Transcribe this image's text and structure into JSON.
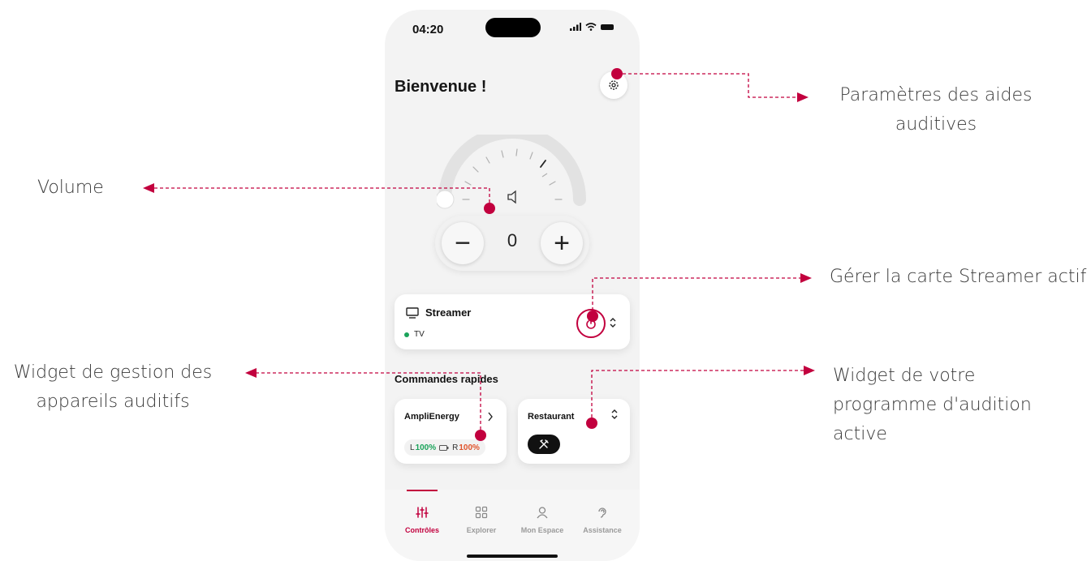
{
  "annotations": {
    "settings": [
      "Paramètres des aides",
      "auditives"
    ],
    "volume": "Volume",
    "streamer": "Gérer la carte Streamer actif",
    "devices": [
      "Widget de gestion des",
      "appareils auditifs"
    ],
    "program": [
      "Widget de votre",
      "programme d'audition",
      "active"
    ]
  },
  "status": {
    "time": "04:20"
  },
  "header": {
    "title": "Bienvenue !"
  },
  "volume": {
    "value": "0",
    "minus": "−",
    "plus": "+"
  },
  "streamer": {
    "title": "Streamer",
    "source": "TV",
    "status_color": "#1aa35a"
  },
  "quick": {
    "title": "Commandes rapides",
    "devices_card": {
      "title": "AmpliEnergy",
      "left_label": "L",
      "left_value": "100%",
      "right_label": "R",
      "right_value": "100%"
    },
    "program_card": {
      "title": "Restaurant",
      "icon": "utensils-icon"
    }
  },
  "tabs": [
    {
      "label": "Contrôles",
      "icon": "sliders-icon",
      "active": true
    },
    {
      "label": "Explorer",
      "icon": "grid-icon",
      "active": false
    },
    {
      "label": "Mon Espace",
      "icon": "user-icon",
      "active": false
    },
    {
      "label": "Assistance",
      "icon": "ear-icon",
      "active": false
    }
  ],
  "colors": {
    "accent": "#c2003e",
    "green": "#1aa35a",
    "orange": "#e0522a"
  }
}
